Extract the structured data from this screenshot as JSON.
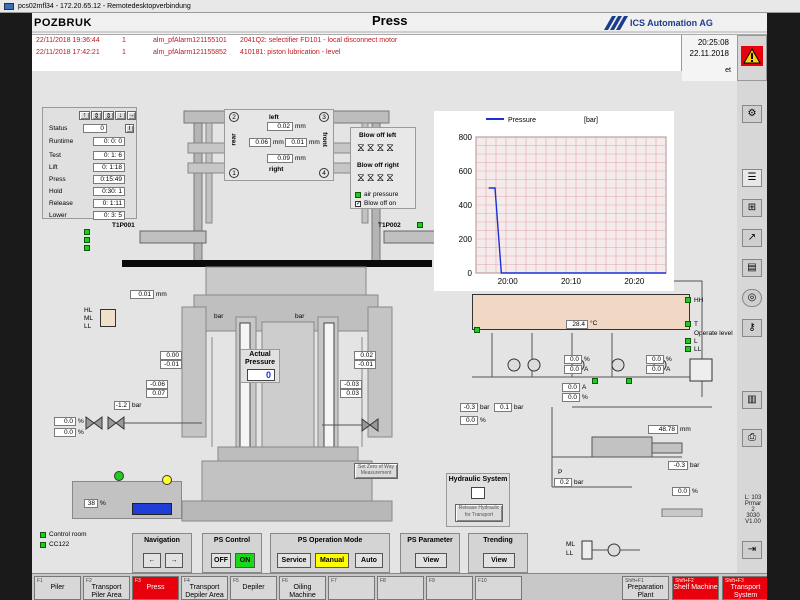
{
  "remote_desktop": {
    "title": "pcs02mfl34 - 172.20.65.12 - Remotedesktopverbindung"
  },
  "header": {
    "brand": "POZBRUK",
    "screen_title": "Press",
    "company": "ICS Automation AG"
  },
  "alarms": [
    {
      "date": "22/11/2018 19:36:44",
      "count": "1",
      "id": "alm_pfAlarm121155101",
      "text": "2041Q2: selectifier FD101 - local disconnect motor"
    },
    {
      "date": "22/11/2018 17:42:21",
      "count": "1",
      "id": "alm_pfAlarm121155852",
      "text": "410181: piston lubrication - level"
    }
  ],
  "clock": {
    "time": "20:25:08",
    "date": "22.11.2018",
    "lang": "et"
  },
  "status_panel": {
    "rows": [
      {
        "label": "Status",
        "value": "0"
      },
      {
        "label": "Runtime",
        "value": "0: 0: 0"
      },
      {
        "label": "Test",
        "value": "0: 1: 6"
      },
      {
        "label": "Lift",
        "value": "0: 1:18"
      },
      {
        "label": "Press",
        "value": "0:15:49"
      },
      {
        "label": "Hold",
        "value": "0:30: 1"
      },
      {
        "label": "Release",
        "value": "0: 1:11"
      },
      {
        "label": "Lower",
        "value": "0: 3: 5"
      }
    ]
  },
  "press_position": {
    "left_label": "left",
    "right_label": "right",
    "rear_label": "rear",
    "front_label": "front",
    "left_val": "0.02",
    "right_val": "0.09",
    "mid_left": "0.06",
    "mid_right": "0.01",
    "unit": "mm",
    "corners": [
      "2",
      "3",
      "1",
      "4"
    ]
  },
  "blowoff": {
    "left_label": "Blow off left",
    "right_label": "Blow off right",
    "air_pressure": "air pressure",
    "blow_off_on": "Blow off on"
  },
  "stations": {
    "left": "T1P001",
    "right": "T1P002"
  },
  "actual_pressure": {
    "label1": "Actual",
    "label2": "Pressure",
    "value": "0"
  },
  "misc_values": {
    "mm_top": "0.01",
    "mm_unit": "mm",
    "hl": "HL",
    "ml": "ML",
    "ll": "LL",
    "bar_left_col": "bar",
    "bar_right_col": "bar",
    "v_00": "0.00",
    "v_001": "-0.01",
    "v_006": "-0.06",
    "v_007": "0.07",
    "v_002": "0.02",
    "v_001b": "-0.01",
    "v_003": "-0.03",
    "v_003b": "0.03",
    "p_neg12": "-1.2",
    "bar": "bar",
    "pct": "%",
    "p_left_a": "0.0",
    "p_left_b": "0.0",
    "p_mid_a": "-0.3",
    "p_mid_b": "0.0",
    "p_mid_c": "0.1",
    "tank_pct": "38",
    "tank_label": "%",
    "set_zero": "Set Zero of Way Measurement",
    "hydraulic_title": "Hydraulic System",
    "release_hydraulic": "Release Hydraulic for Transport",
    "temp": "28.4",
    "temp_unit": "°C",
    "hh": "HH",
    "t_lbl": "T",
    "operate_level": "Operate level",
    "l_lbl": "L",
    "ll_lbl": "LL",
    "pump_a": "0.0",
    "pump_b": "0.0",
    "pump_c": "0.0",
    "pump_d": "0.0",
    "pump_e": "0.0",
    "pump_f": "0.0",
    "a_unit": "A",
    "cyl_pos": "48.78",
    "cyl_unit": "mm",
    "p_right": "-0.3",
    "p_right_unit": "bar",
    "p_low": "0.2",
    "p_low_unit": "bar",
    "pct_right": "0.0",
    "p_lbl": "P"
  },
  "legend_items": [
    {
      "label": "Control room"
    },
    {
      "label": "CC122"
    }
  ],
  "controls": {
    "navigation": {
      "title": "Navigation",
      "prev": "←",
      "next": "→"
    },
    "ps_control": {
      "title": "PS Control",
      "off": "OFF",
      "on": "ON"
    },
    "ps_mode": {
      "title": "PS Operation Mode",
      "service": "Service",
      "manual": "Manual",
      "auto": "Auto"
    },
    "ps_param": {
      "title": "PS Parameter",
      "view": "View"
    },
    "trending": {
      "title": "Trending",
      "view": "View"
    }
  },
  "right_info": {
    "l1": "L: 103",
    "l2": "Prmar",
    "l3": "2",
    "l4": "3030",
    "l5": "V1.00"
  },
  "fkeys": [
    {
      "key": "F1",
      "label": "Piler"
    },
    {
      "key": "F2",
      "label": "Transport Piler Area"
    },
    {
      "key": "F3",
      "label": "Press"
    },
    {
      "key": "F4",
      "label": "Transport Depiler Area"
    },
    {
      "key": "F5",
      "label": "Depiler"
    },
    {
      "key": "F6",
      "label": "Oiling Machine"
    },
    {
      "key": "F7",
      "label": ""
    },
    {
      "key": "F8",
      "label": ""
    },
    {
      "key": "F9",
      "label": ""
    },
    {
      "key": "F10",
      "label": ""
    },
    {
      "key": "Shift+F1",
      "label": "Preparation Plant"
    },
    {
      "key": "Shift+F2",
      "label": "Shelf Machine"
    },
    {
      "key": "Shift+F3",
      "label": "Transport System"
    }
  ],
  "chart_data": {
    "type": "line",
    "title": "",
    "legend": [
      "Pressure"
    ],
    "unit_label": "[bar]",
    "x_ticks": [
      "20:00",
      "20:10",
      "20:20"
    ],
    "y_ticks": [
      0,
      200,
      400,
      600,
      800
    ],
    "ylim": [
      0,
      800
    ],
    "grid": true,
    "series": [
      {
        "name": "Pressure",
        "x": [
          "19:57",
          "19:58",
          "19:58:30",
          "19:59",
          "20:00",
          "20:10",
          "20:20",
          "20:25"
        ],
        "values": [
          500,
          500,
          250,
          0,
          0,
          0,
          0,
          0
        ]
      }
    ],
    "colors": {
      "line": "#1a2fd6",
      "grid": "#e8a3a3",
      "bg": "#f4ecec"
    }
  }
}
